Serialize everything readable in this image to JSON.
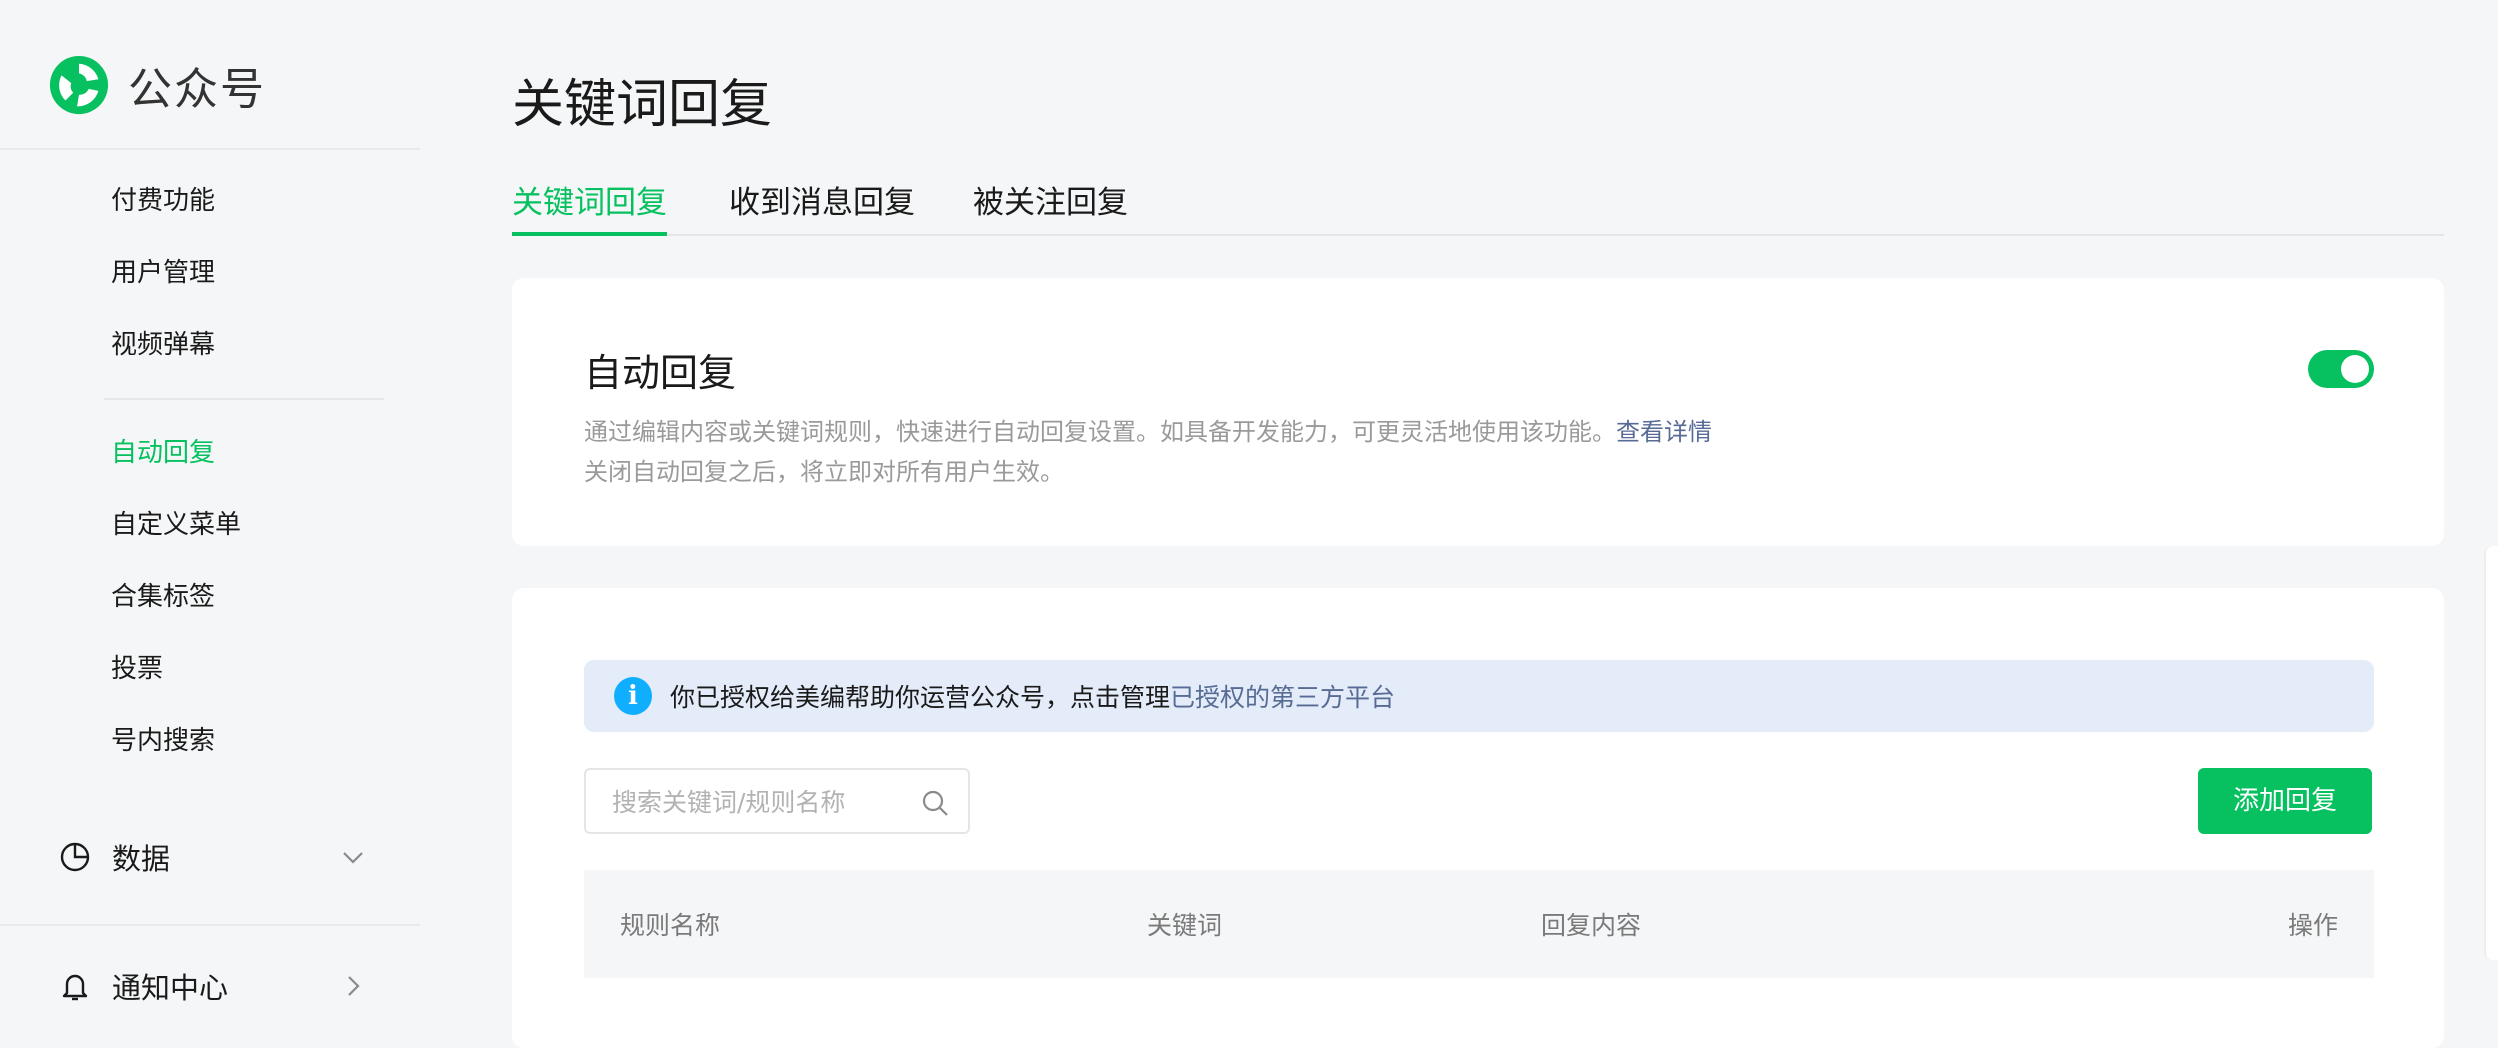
{
  "brand": {
    "name": "公众号",
    "icon": "wechat-official-logo"
  },
  "sidebar": {
    "items_top": [
      {
        "label": "付费功能"
      },
      {
        "label": "用户管理"
      },
      {
        "label": "视频弹幕"
      }
    ],
    "items_bottom": [
      {
        "label": "自动回复",
        "active": true
      },
      {
        "label": "自定义菜单"
      },
      {
        "label": "合集标签"
      },
      {
        "label": "投票"
      },
      {
        "label": "号内搜索"
      }
    ],
    "data_group": {
      "label": "数据",
      "icon": "pie-chart-icon",
      "arrow": "chevron-down-icon"
    },
    "notify_group": {
      "label": "通知中心",
      "icon": "bell-icon",
      "arrow": "chevron-right-icon"
    }
  },
  "page": {
    "title": "关键词回复"
  },
  "tabs": [
    {
      "label": "关键词回复",
      "active": true
    },
    {
      "label": "收到消息回复"
    },
    {
      "label": "被关注回复"
    }
  ],
  "auto_reply": {
    "title": "自动回复",
    "desc_line1": "通过编辑内容或关键词规则，快速进行自动回复设置。如具备开发能力，可更灵活地使用该功能。",
    "desc_link": "查看详情",
    "desc_line2": "关闭自动回复之后，将立即对所有用户生效。",
    "enabled": true
  },
  "notice": {
    "text": "你已授权给美编帮助你运营公众号，点击管理",
    "link": "已授权的第三方平台"
  },
  "search": {
    "placeholder": "搜索关键词/规则名称",
    "value": ""
  },
  "add_button": {
    "label": "添加回复"
  },
  "table": {
    "columns": [
      "规则名称",
      "关键词",
      "回复内容",
      "操作"
    ]
  },
  "colors": {
    "accent": "#07c160",
    "link": "#576b95",
    "info": "#10aeff"
  }
}
